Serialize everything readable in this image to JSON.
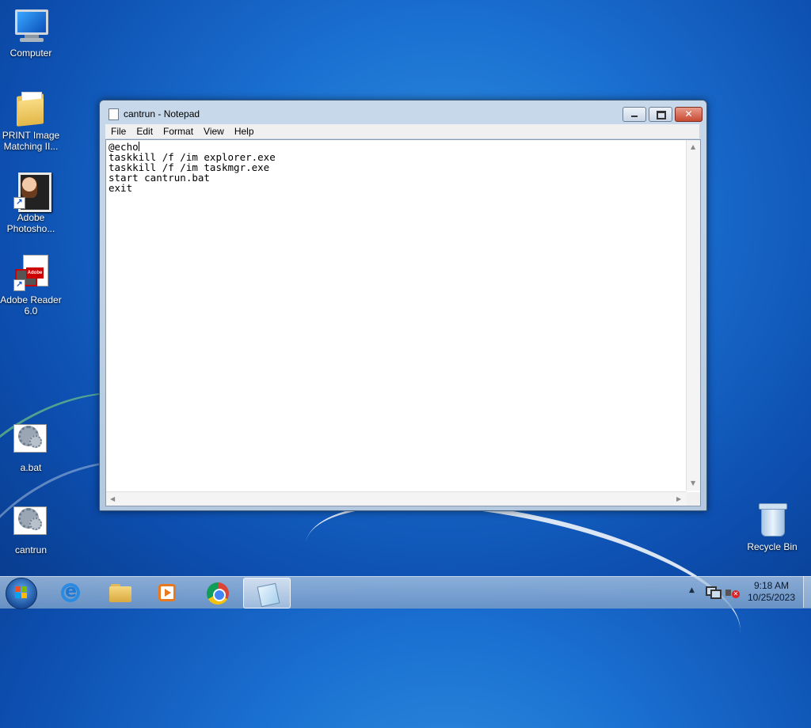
{
  "desktop": {
    "icons": [
      {
        "label": "Computer"
      },
      {
        "label": "PRINT Image Matching II..."
      },
      {
        "label": "Adobe Photosho..."
      },
      {
        "label": "Adobe Reader 6.0"
      },
      {
        "label": "a.bat"
      },
      {
        "label": "cantrun"
      },
      {
        "label": "Recycle Bin"
      }
    ],
    "reader_badge": "Adobe"
  },
  "notepad": {
    "title": "cantrun - Notepad",
    "menu": [
      "File",
      "Edit",
      "Format",
      "View",
      "Help"
    ],
    "close_glyph": "✕",
    "lines": [
      "@echo",
      "taskkill /f /im explorer.exe",
      "taskkill /f /im taskmgr.exe",
      "start cantrun.bat",
      "exit"
    ]
  },
  "taskbar": {
    "apps": [
      "start-button",
      "internet-explorer",
      "windows-explorer",
      "windows-media-player",
      "google-chrome",
      "notepad"
    ],
    "active_app": "notepad"
  },
  "tray": {
    "time": "9:18 AM",
    "date": "10/25/2023",
    "volume_muted": true
  }
}
